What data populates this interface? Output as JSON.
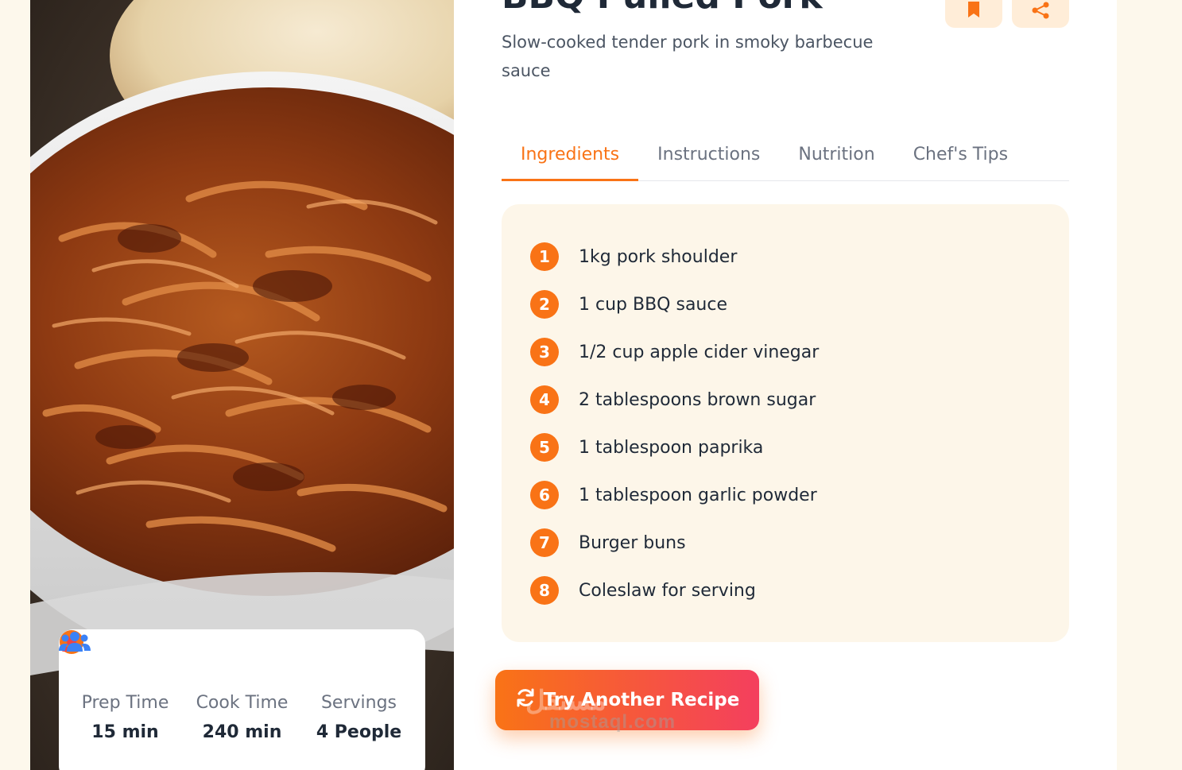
{
  "recipe": {
    "title": "BBQ Pulled Pork",
    "subtitle": "Slow-cooked tender pork in smoky barbecue sauce"
  },
  "actions": {
    "bookmark_icon": "bookmark-icon",
    "share_icon": "share-icon",
    "accent_color": "#f97316",
    "button_bg": "#ffedd8"
  },
  "tabs": [
    {
      "label": "Ingredients",
      "active": true
    },
    {
      "label": "Instructions",
      "active": false
    },
    {
      "label": "Nutrition",
      "active": false
    },
    {
      "label": "Chef's Tips",
      "active": false
    }
  ],
  "ingredients": [
    {
      "num": "1",
      "text": "1kg pork shoulder"
    },
    {
      "num": "2",
      "text": "1 cup BBQ sauce"
    },
    {
      "num": "3",
      "text": "1/2 cup apple cider vinegar"
    },
    {
      "num": "4",
      "text": "2 tablespoons brown sugar"
    },
    {
      "num": "5",
      "text": "1 tablespoon paprika"
    },
    {
      "num": "6",
      "text": "1 tablespoon garlic powder"
    },
    {
      "num": "7",
      "text": "Burger buns"
    },
    {
      "num": "8",
      "text": "Coleslaw for serving"
    }
  ],
  "stats": [
    {
      "label": "Prep Time",
      "value": "15 min",
      "icon": "clock-icon",
      "color": "#f97316"
    },
    {
      "label": "Cook Time",
      "value": "240 min",
      "icon": "fire-burner-icon",
      "color": "#ef4444"
    },
    {
      "label": "Servings",
      "value": "4 People",
      "icon": "users-icon",
      "color": "#3b82f6"
    }
  ],
  "cta": {
    "label": "Try Another Recipe",
    "icon": "refresh-icon"
  },
  "watermark": {
    "text": "mostaql.com",
    "logo": "مستقل"
  }
}
